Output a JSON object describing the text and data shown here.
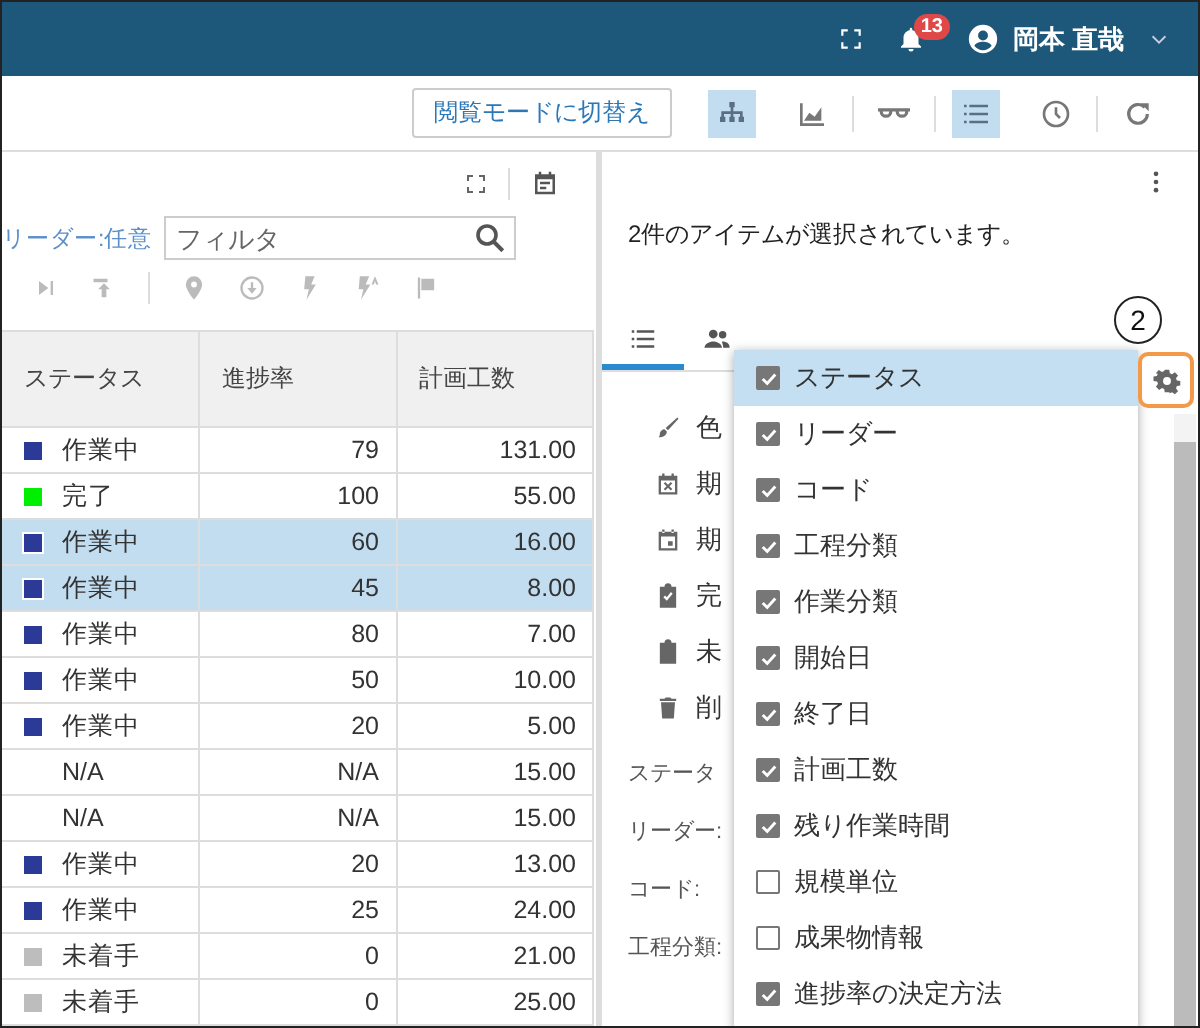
{
  "header": {
    "notification_count": "13",
    "user_name": "岡本 直哉"
  },
  "toolbar": {
    "switch_button": "閲覧モードに切替え",
    "view_buttons": [
      {
        "kind": "hierarchy",
        "selected": true
      },
      {
        "kind": "chart",
        "selected": false
      },
      {
        "kind": "glasses",
        "selected": false
      },
      {
        "kind": "list",
        "selected": true
      },
      {
        "kind": "clock",
        "selected": false
      },
      {
        "kind": "refresh",
        "selected": false
      }
    ]
  },
  "left_panel": {
    "filter_label": "リーダー:任意",
    "filter": {
      "placeholder": "フィルタ"
    },
    "table": {
      "columns": [
        "ステータス",
        "進捗率",
        "計画工数"
      ],
      "rows": [
        {
          "status": "作業中",
          "color": "#2b3a96",
          "progress": "79",
          "planned_hours": "131.00",
          "selected": false
        },
        {
          "status": "完了",
          "color": "#00ee00",
          "progress": "100",
          "planned_hours": "55.00",
          "selected": false
        },
        {
          "status": "作業中",
          "color": "#2b3a96",
          "progress": "60",
          "planned_hours": "16.00",
          "selected": true
        },
        {
          "status": "作業中",
          "color": "#2b3a96",
          "progress": "45",
          "planned_hours": "8.00",
          "selected": true
        },
        {
          "status": "作業中",
          "color": "#2b3a96",
          "progress": "80",
          "planned_hours": "7.00",
          "selected": false
        },
        {
          "status": "作業中",
          "color": "#2b3a96",
          "progress": "50",
          "planned_hours": "10.00",
          "selected": false
        },
        {
          "status": "作業中",
          "color": "#2b3a96",
          "progress": "20",
          "planned_hours": "5.00",
          "selected": false
        },
        {
          "status": "N/A",
          "progress": "N/A",
          "planned_hours": "15.00",
          "selected": false
        },
        {
          "status": "N/A",
          "progress": "N/A",
          "planned_hours": "15.00",
          "selected": false
        },
        {
          "status": "作業中",
          "color": "#2b3a96",
          "progress": "20",
          "planned_hours": "13.00",
          "selected": false
        },
        {
          "status": "作業中",
          "color": "#2b3a96",
          "progress": "25",
          "planned_hours": "24.00",
          "selected": false
        },
        {
          "status": "未着手",
          "color": "#bdbdbd",
          "progress": "0",
          "planned_hours": "21.00",
          "selected": false
        },
        {
          "status": "未着手",
          "color": "#bdbdbd",
          "progress": "0",
          "planned_hours": "25.00",
          "selected": false
        }
      ]
    }
  },
  "right_panel": {
    "message": "2件のアイテムが選択されています。",
    "annotation": "2",
    "tabs": [
      {
        "kind": "list",
        "selected": true
      },
      {
        "kind": "people",
        "selected": false
      }
    ],
    "actions": [
      {
        "kind": "brush",
        "label": "色"
      },
      {
        "kind": "calendar-x",
        "label": "期"
      },
      {
        "kind": "calendar",
        "label": "期"
      },
      {
        "kind": "clipboard-check",
        "label": "完"
      },
      {
        "kind": "clipboard",
        "label": "未"
      },
      {
        "kind": "trash",
        "label": "削"
      }
    ],
    "fields": [
      "ステータ",
      "リーダー:",
      "コード:",
      "工程分類:"
    ],
    "column_menu": {
      "items": [
        {
          "label": "ステータス",
          "checked": true,
          "selected": true
        },
        {
          "label": "リーダー",
          "checked": true,
          "selected": false
        },
        {
          "label": "コード",
          "checked": true,
          "selected": false
        },
        {
          "label": "工程分類",
          "checked": true,
          "selected": false
        },
        {
          "label": "作業分類",
          "checked": true,
          "selected": false
        },
        {
          "label": "開始日",
          "checked": true,
          "selected": false
        },
        {
          "label": "終了日",
          "checked": true,
          "selected": false
        },
        {
          "label": "計画工数",
          "checked": true,
          "selected": false
        },
        {
          "label": "残り作業時間",
          "checked": true,
          "selected": false
        },
        {
          "label": "規模単位",
          "checked": false,
          "selected": false
        },
        {
          "label": "成果物情報",
          "checked": false,
          "selected": false
        },
        {
          "label": "進捗率の決定方法",
          "checked": true,
          "selected": false
        }
      ]
    }
  }
}
